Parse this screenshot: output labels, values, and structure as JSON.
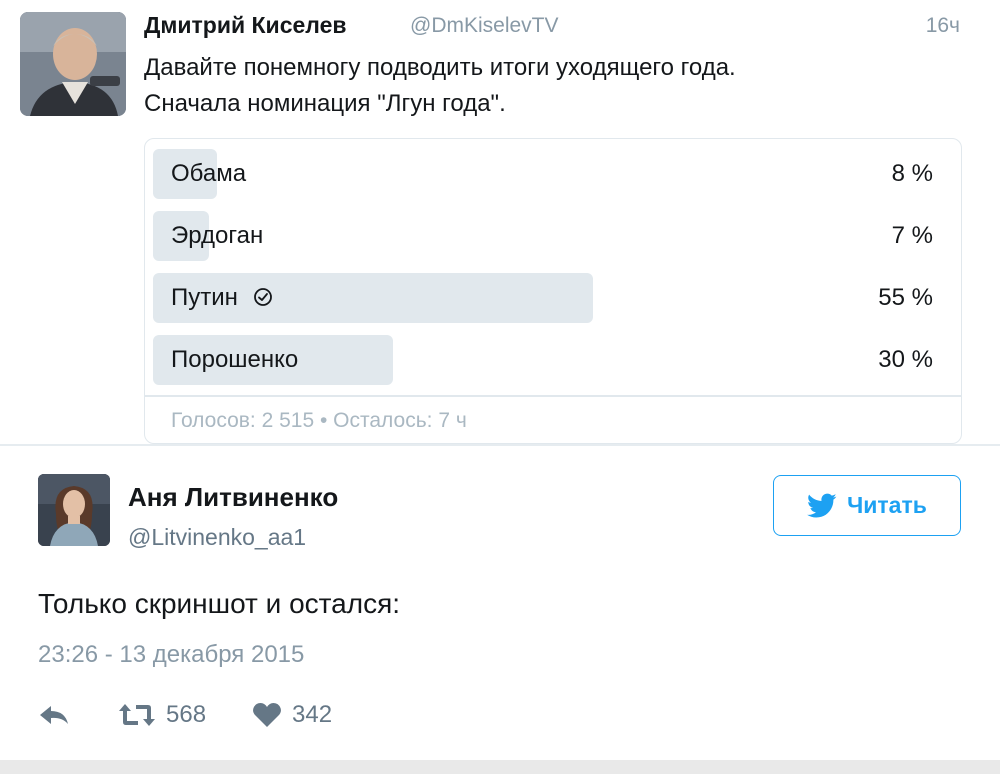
{
  "quoted_tweet": {
    "author_name": "Дмитрий Киселев",
    "author_handle": "@DmKiselevTV",
    "time_ago": "16ч",
    "text_lines": [
      "Давайте понемногу подводить итоги уходящего года.",
      "Сначала номинация \"Лгун года\"."
    ],
    "poll": {
      "options": [
        {
          "label": "Обама",
          "percent_label": "8 %",
          "percent": 8
        },
        {
          "label": "Эрдоган",
          "percent_label": "7 %",
          "percent": 7
        },
        {
          "label": "Путин",
          "percent_label": "55 %",
          "percent": 55,
          "selected": true
        },
        {
          "label": "Порошенко",
          "percent_label": "30 %",
          "percent": 30
        }
      ],
      "footer": "Голосов: 2 515 • Осталось: 7 ч"
    }
  },
  "tweet": {
    "author_name": "Аня Литвиненко",
    "author_handle": "@Litvinenko_aa1",
    "follow_label": "Читать",
    "text": "Только скриншот и остался:",
    "date": "23:26 - 13 декабря 2015",
    "actions": {
      "reply_icon": "reply-icon",
      "retweet_icon": "retweet-icon",
      "retweet_count": "568",
      "like_icon": "heart-icon",
      "like_count": "342"
    }
  },
  "colors": {
    "accent": "#1da1f2",
    "poll_bar": "#e1e8ed",
    "muted_text": "#8899a6",
    "action_gray": "#657786"
  }
}
